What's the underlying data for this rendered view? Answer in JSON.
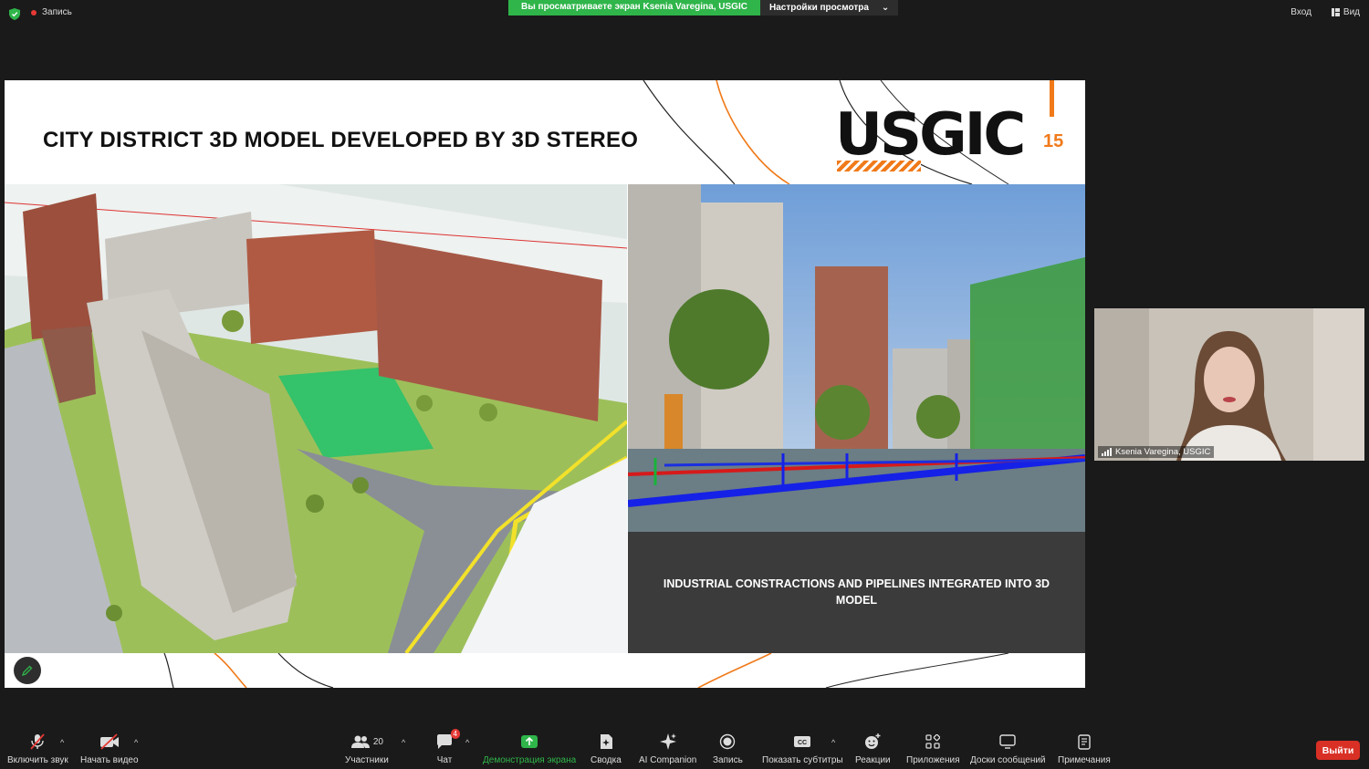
{
  "topbar": {
    "recording_label": "Запись",
    "share_banner": "Вы просматриваете экран Ksenia Varegina, USGIC",
    "view_options": "Настройки просмотра",
    "signin": "Вход",
    "view": "Вид"
  },
  "slide": {
    "title": "CITY DISTRICT 3D MODEL DEVELOPED BY 3D STEREO",
    "logo_text": "USGIC",
    "logo_number": "15",
    "caption": "INDUSTRIAL CONSTRACTIONS AND PIPELINES INTEGRATED INTO 3D MODEL"
  },
  "participant": {
    "name": "Ksenia Varegina, USGIC"
  },
  "toolbar": {
    "mute": "Включить звук",
    "video": "Начать видео",
    "participants": "Участники",
    "participants_count": "20",
    "chat": "Чат",
    "chat_badge": "4",
    "share": "Демонстрация экрана",
    "summary": "Сводка",
    "ai": "AI Companion",
    "record": "Запись",
    "captions": "Показать субтитры",
    "reactions": "Реакции",
    "apps": "Приложения",
    "whiteboards": "Доски сообщений",
    "notes": "Примечания",
    "leave": "Выйти"
  },
  "colors": {
    "zoom_green": "#2fb54a",
    "leave_red": "#d93025",
    "accent_orange": "#f07a1a"
  }
}
